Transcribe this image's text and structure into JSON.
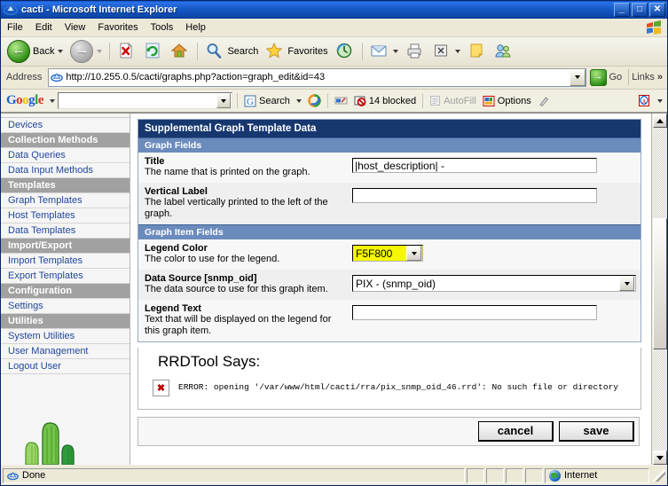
{
  "window": {
    "title": "cacti - Microsoft Internet Explorer",
    "app_icon": "ie-icon",
    "minimize_label": "_",
    "maximize_label": "□",
    "close_label": "✕"
  },
  "menubar": {
    "items": [
      {
        "label": "File"
      },
      {
        "label": "Edit"
      },
      {
        "label": "View"
      },
      {
        "label": "Favorites"
      },
      {
        "label": "Tools"
      },
      {
        "label": "Help"
      }
    ],
    "brand_icon": "windows-flag-icon"
  },
  "toolbar": {
    "back_label": "Back",
    "back_icon": "back-arrow-icon",
    "forward_icon": "forward-arrow-icon",
    "stop_icon": "stop-icon",
    "refresh_icon": "refresh-icon",
    "home_icon": "home-icon",
    "search_label": "Search",
    "search_icon": "magnifier-icon",
    "favorites_label": "Favorites",
    "favorites_icon": "star-icon",
    "history_icon": "history-icon",
    "mail_icon": "mail-icon",
    "print_icon": "printer-icon",
    "edit_icon": "edit-page-icon",
    "notes_icon": "note-icon",
    "messenger_icon": "messenger-icon"
  },
  "address": {
    "label": "Address",
    "url": "http://10.255.0.5/cacti/graphs.php?action=graph_edit&id=43",
    "site_icon": "ie-page-icon",
    "dropdown_icon": "chevron-down-icon",
    "go_label": "Go",
    "go_icon": "go-arrow-icon",
    "links_label": "Links",
    "links_chevron": "»"
  },
  "google_toolbar": {
    "logo": {
      "g1": "G",
      "o1": "o",
      "o2": "o",
      "g2": "g",
      "l": "l",
      "e": "e"
    },
    "logo_caret": "chevron-down-icon",
    "search_value": "",
    "search_dropdown_icon": "chevron-down-icon",
    "search_label": "Search",
    "search_icon": "google-search-icon",
    "search_caret": "chevron-down-icon",
    "highlight_icon": "swirl-icon",
    "pagerank_icon": "pagerank-icon",
    "blocked_label": "14 blocked",
    "blocked_icon": "popup-blocker-icon",
    "autofill_label": "AutoFill",
    "autofill_icon": "autofill-icon",
    "options_label": "Options",
    "options_icon": "options-icon",
    "highlighter_icon": "highlighter-icon",
    "right_icon": "acrobat-icon",
    "right_caret": "chevron-down-icon"
  },
  "sidebar": {
    "items": [
      {
        "label": "Devices",
        "type": "link"
      },
      {
        "label": "Collection Methods",
        "type": "header"
      },
      {
        "label": "Data Queries",
        "type": "link"
      },
      {
        "label": "Data Input Methods",
        "type": "link"
      },
      {
        "label": "Templates",
        "type": "header"
      },
      {
        "label": "Graph Templates",
        "type": "link"
      },
      {
        "label": "Host Templates",
        "type": "link"
      },
      {
        "label": "Data Templates",
        "type": "link"
      },
      {
        "label": "Import/Export",
        "type": "header"
      },
      {
        "label": "Import Templates",
        "type": "link"
      },
      {
        "label": "Export Templates",
        "type": "link"
      },
      {
        "label": "Configuration",
        "type": "header"
      },
      {
        "label": "Settings",
        "type": "link"
      },
      {
        "label": "Utilities",
        "type": "header"
      },
      {
        "label": "System Utilities",
        "type": "link"
      },
      {
        "label": "User Management",
        "type": "link"
      },
      {
        "label": "Logout User",
        "type": "link"
      }
    ],
    "logo_icon": "cactus-logo"
  },
  "form": {
    "box_title": "Supplemental Graph Template Data",
    "sections": [
      {
        "heading": "Graph Fields",
        "fields": [
          {
            "title": "Title",
            "description": "The name that is printed on the graph.",
            "control": "text",
            "value": "|host_description| -",
            "placeholder": ""
          },
          {
            "title": "Vertical Label",
            "description": "The label vertically printed to the left of the graph.",
            "control": "text",
            "value": "",
            "placeholder": ""
          }
        ]
      },
      {
        "heading": "Graph Item Fields",
        "fields": [
          {
            "title": "Legend Color",
            "description": "The color to use for the legend.",
            "control": "select-color",
            "value": "F5F800",
            "swatch_color": "#f5f800"
          },
          {
            "title": "Data Source [snmp_oid]",
            "description": "The data source to use for this graph item.",
            "control": "select",
            "value": "PIX - (snmp_oid)"
          },
          {
            "title": "Legend Text",
            "description": "Text that will be displayed on the legend for this graph item.",
            "control": "text",
            "value": "",
            "placeholder": ""
          }
        ]
      }
    ]
  },
  "rrdtool": {
    "heading": "RRDTool Says:",
    "error_icon": "broken-image-icon",
    "error_text": "ERROR: opening '/var/www/html/cacti/rra/pix_snmp_oid_46.rrd': No such file or directory"
  },
  "actions": {
    "cancel_label": "cancel",
    "save_label": "save"
  },
  "scrollbar": {
    "up_icon": "scroll-up-icon",
    "down_icon": "scroll-down-icon"
  },
  "statusbar": {
    "status_text": "Done",
    "status_icon": "ie-page-icon",
    "zone_text": "Internet",
    "zone_icon": "globe-icon"
  },
  "colors": {
    "title_bar": "#1559c8",
    "box_title_bg": "#17376f",
    "section_head_bg": "#6b8bbd",
    "sidebar_header_bg": "#a1a1a1",
    "link_color": "#22479c",
    "legend_color_swatch": "#f5f800"
  }
}
